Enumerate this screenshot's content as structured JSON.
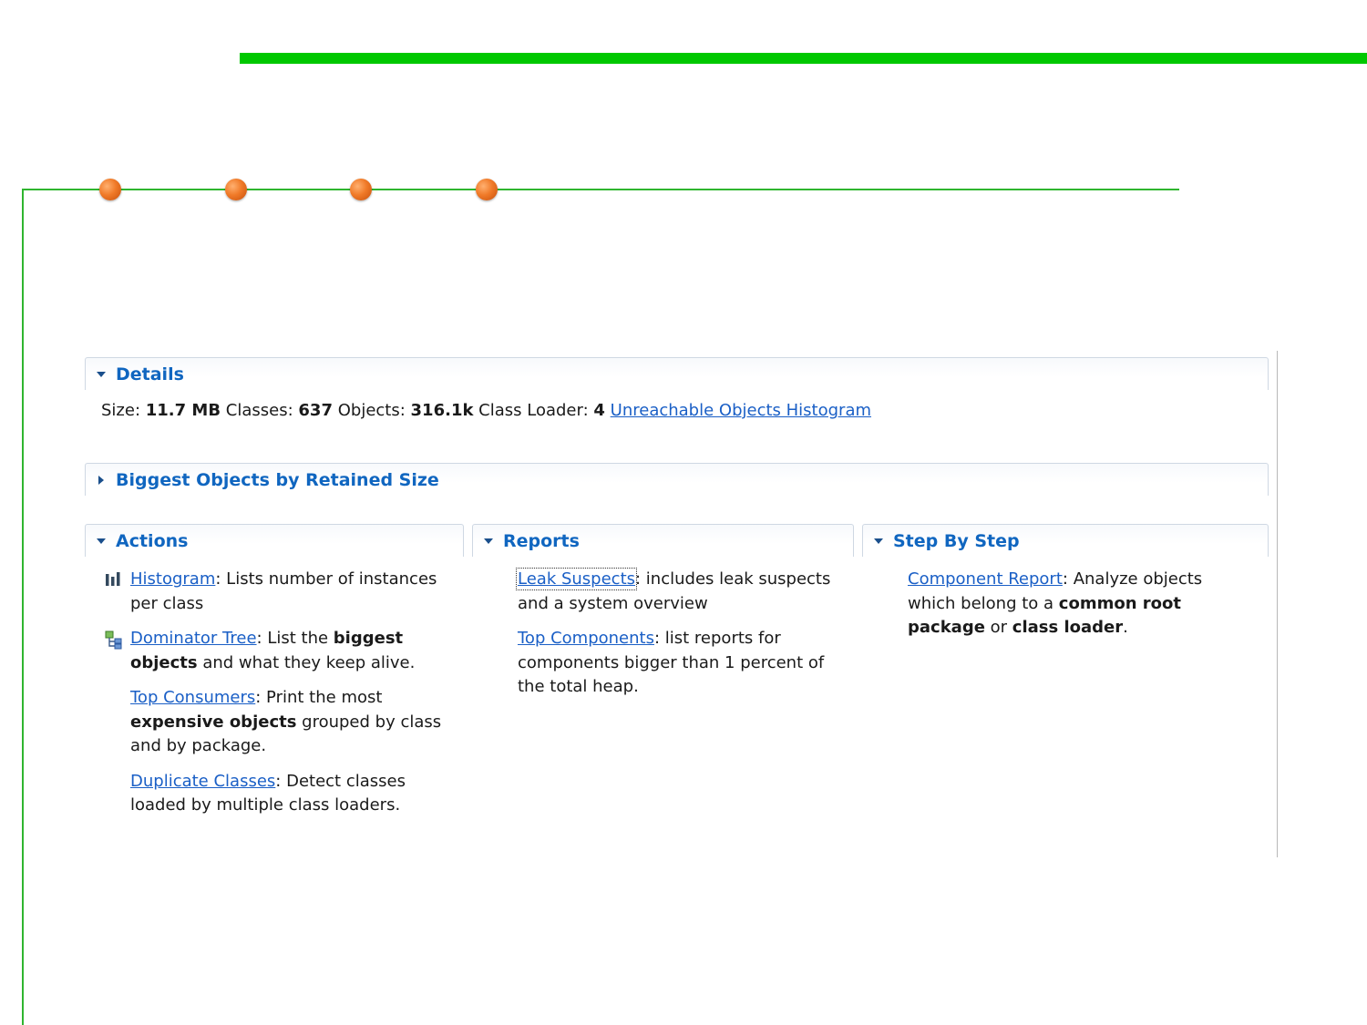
{
  "details": {
    "header": "Details",
    "size_label": "Size:",
    "size_value": "11.7 MB",
    "classes_label": "Classes:",
    "classes_value": "637",
    "objects_label": "Objects:",
    "objects_value": "316.1k",
    "loader_label": "Class Loader:",
    "loader_value": "4",
    "unreachable_link": "Unreachable Objects Histogram"
  },
  "biggest": {
    "header": "Biggest Objects by Retained Size"
  },
  "actions": {
    "header": "Actions",
    "histogram": {
      "link": "Histogram",
      "text": ": Lists number of instances per class"
    },
    "dominator": {
      "link": "Dominator Tree",
      "text1": ": List the ",
      "bold1": "biggest objects",
      "text2": " and what they keep alive."
    },
    "consumers": {
      "link": "Top Consumers",
      "text1": ": Print the most ",
      "bold1": "expensive objects",
      "text2": " grouped by class and by package."
    },
    "duplicate": {
      "link": "Duplicate Classes",
      "text": ": Detect classes loaded by multiple class loaders."
    }
  },
  "reports": {
    "header": "Reports",
    "leak": {
      "link": "Leak Suspects",
      "text": ": includes leak suspects and a system overview"
    },
    "topcomp": {
      "link": "Top Components",
      "text": ": list reports for components bigger than 1 percent of the total heap."
    }
  },
  "stepbystep": {
    "header": "Step By Step",
    "component": {
      "link": "Component Report",
      "text1": ": Analyze objects which belong to a ",
      "bold1": "common root package",
      "text2": " or ",
      "bold2": "class loader",
      "text3": "."
    }
  },
  "colors": {
    "accent_green": "#00c800",
    "dot_orange": "#f07a28",
    "link_blue": "#1a5fc6",
    "header_blue": "#1066c0"
  },
  "icons": [
    "chevron-down-icon",
    "chevron-right-icon",
    "histogram-icon",
    "dominator-tree-icon"
  ]
}
